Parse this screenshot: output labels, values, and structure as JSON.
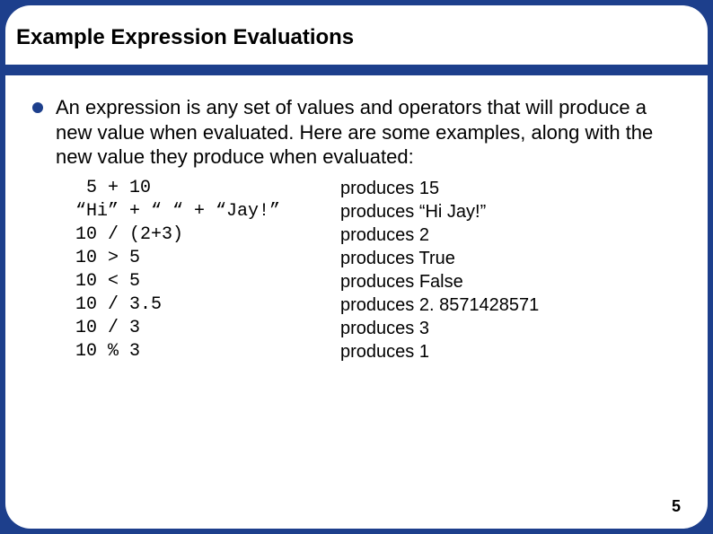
{
  "title": "Example Expression Evaluations",
  "intro": "An expression is any set of values and operators that will produce a new value when evaluated. Here are some examples, along with the new value they produce when evaluated:",
  "rows": [
    {
      "expr": " 5 + 10",
      "result": "produces 15"
    },
    {
      "expr": "“Hi” + “ “ + “Jay!”",
      "result": "produces “Hi Jay!”"
    },
    {
      "expr": "10 / (2+3)",
      "result": "produces 2"
    },
    {
      "expr": "10 > 5",
      "result": "produces True"
    },
    {
      "expr": "10 < 5",
      "result": "produces False"
    },
    {
      "expr": "10 / 3.5",
      "result": "produces 2. 8571428571"
    },
    {
      "expr": "10 / 3",
      "result": "produces 3"
    },
    {
      "expr": "10 % 3",
      "result": "produces 1"
    }
  ],
  "page_number": "5"
}
